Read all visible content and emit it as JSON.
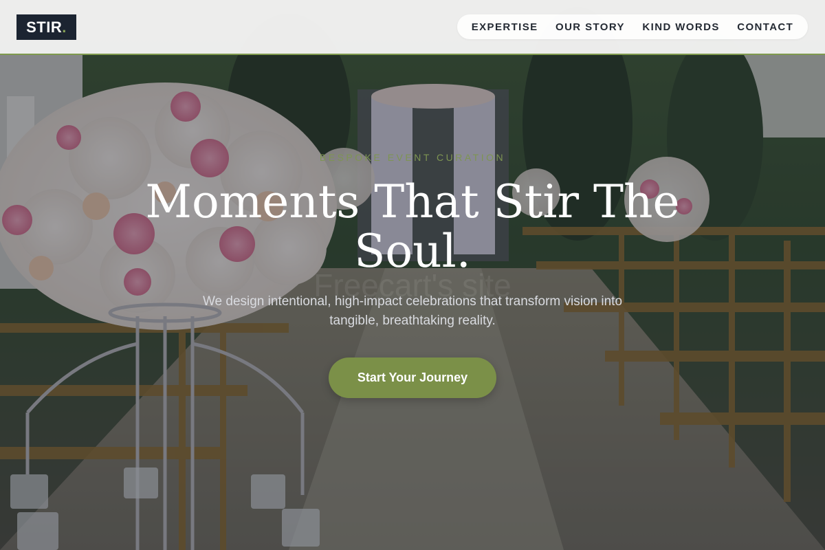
{
  "header": {
    "logo_text": "STIR",
    "logo_dot": ".",
    "nav": [
      {
        "label": "EXPERTISE"
      },
      {
        "label": "OUR STORY"
      },
      {
        "label": "KIND WORDS"
      },
      {
        "label": "CONTACT"
      }
    ]
  },
  "hero": {
    "eyebrow": "BESPOKE EVENT CURATION",
    "headline_line1": "Moments That Stir The",
    "headline_line2": "Soul.",
    "watermark": "Freecart's site",
    "subtext": "We design intentional, high-impact celebrations that transform vision into tangible, breathtaking reality.",
    "cta_label": "Start Your Journey"
  },
  "colors": {
    "accent_green": "#7b9048",
    "logo_bg": "#1c2431",
    "header_border": "#7f9a4d"
  }
}
